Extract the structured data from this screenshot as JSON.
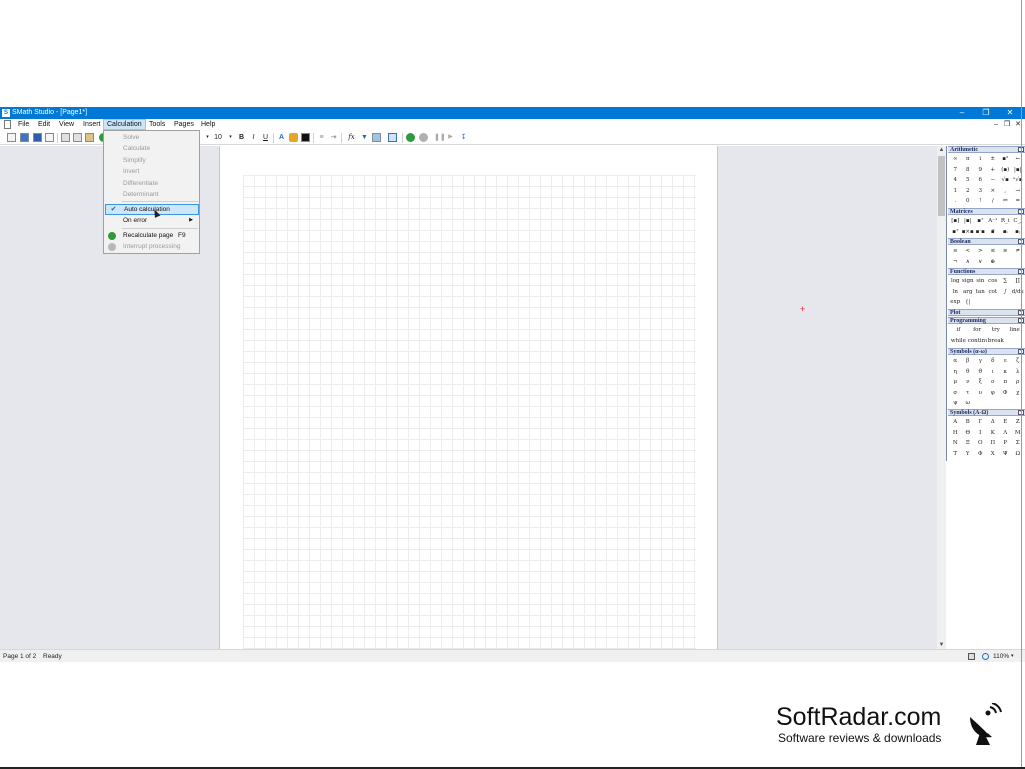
{
  "window": {
    "title": "SMath Studio - [Page1*]",
    "icon_letter": "S",
    "controls": [
      "–",
      "❐",
      "✕"
    ]
  },
  "menubar": {
    "items": [
      "File",
      "Edit",
      "View",
      "Insert",
      "Calculation",
      "Tools",
      "Pages",
      "Help"
    ],
    "active": "Calculation",
    "mdi_controls": [
      "–",
      "❐",
      "✕"
    ]
  },
  "toolbar": {
    "font_size": "10",
    "bold": "B",
    "italic": "I",
    "underline": "U",
    "text_color": "A",
    "fx": "fx"
  },
  "calculation_menu": {
    "items": [
      {
        "label": "Solve",
        "enabled": false
      },
      {
        "label": "Calculate",
        "enabled": false
      },
      {
        "label": "Simplify",
        "enabled": false
      },
      {
        "label": "Invert",
        "enabled": false
      },
      {
        "label": "Differentiate",
        "enabled": false
      },
      {
        "label": "Determinant",
        "enabled": false
      },
      {
        "label": "Auto calculation",
        "enabled": true,
        "checked": true
      },
      {
        "label": "On error",
        "enabled": true,
        "submenu": true
      },
      {
        "label": "Recalculate page",
        "enabled": true,
        "shortcut": "F9",
        "icon": "recalculate-icon"
      },
      {
        "label": "Interrupt processing",
        "enabled": false,
        "icon": "interrupt-icon"
      }
    ]
  },
  "side_panel": {
    "sections": [
      {
        "title": "Arithmetic",
        "toggle": "⊟",
        "cells": [
          "∞",
          "π",
          "i",
          "±",
          "▪²",
          "←",
          "7",
          "8",
          "9",
          "+",
          "(▪)",
          "|▪|",
          "4",
          "5",
          "6",
          "−",
          "√▪",
          "ⁿ√▪",
          "1",
          "2",
          "3",
          "×",
          ",",
          "→",
          ".",
          "0",
          "!",
          "/",
          "≔",
          "="
        ]
      },
      {
        "title": "Matrices",
        "toggle": "⊟",
        "cells": [
          "[▪]",
          "|▪|",
          "▪ᵀ",
          "A⁻¹",
          "R_i",
          "C_j",
          "▪ᵀ",
          "▪×▪",
          "▪·▪",
          "▪⃗",
          "▪ᵢ",
          "▪ⱼ"
        ]
      },
      {
        "title": "Boolean",
        "toggle": "⊟",
        "cells": [
          "≡",
          "<",
          ">",
          "≤",
          "≥",
          "≠",
          "¬",
          "∧",
          "∨",
          "⊕"
        ]
      },
      {
        "title": "Functions",
        "toggle": "⊟",
        "cells": [
          "log",
          "sign",
          "sin",
          "cos",
          "∑",
          "∏",
          "ln",
          "arg",
          "tan",
          "cot",
          "∫",
          "d/dx",
          "exp",
          "{|"
        ]
      },
      {
        "title": "Plot",
        "toggle": "⊞",
        "cells": []
      },
      {
        "title": "Programming",
        "toggle": "⊟",
        "cells": [
          "if",
          "for",
          "try",
          "line",
          "while",
          "continue",
          "break",
          ""
        ]
      },
      {
        "title": "Symbols (α-ω)",
        "toggle": "⊟",
        "cells": [
          "α",
          "β",
          "γ",
          "δ",
          "ε",
          "ζ",
          "η",
          "θ",
          "ϑ",
          "ι",
          "κ",
          "λ",
          "μ",
          "ν",
          "ξ",
          "ο",
          "π",
          "ρ",
          "σ",
          "τ",
          "υ",
          "φ",
          "Φ",
          "χ",
          "ψ",
          "ω"
        ]
      },
      {
        "title": "Symbols (Α-Ω)",
        "toggle": "⊟",
        "cells": [
          "Α",
          "Β",
          "Γ",
          "Δ",
          "Ε",
          "Ζ",
          "Η",
          "Θ",
          "Ι",
          "Κ",
          "Λ",
          "Μ",
          "Ν",
          "Ξ",
          "Ο",
          "Π",
          "Ρ",
          "Σ",
          "Τ",
          "Υ",
          "Φ",
          "Χ",
          "Ψ",
          "Ω"
        ]
      }
    ]
  },
  "statusbar": {
    "page": "Page 1 of 2",
    "state": "Ready",
    "zoom": "110%"
  },
  "watermark": {
    "name": "SoftRadar.com",
    "tagline": "Software reviews & downloads"
  }
}
